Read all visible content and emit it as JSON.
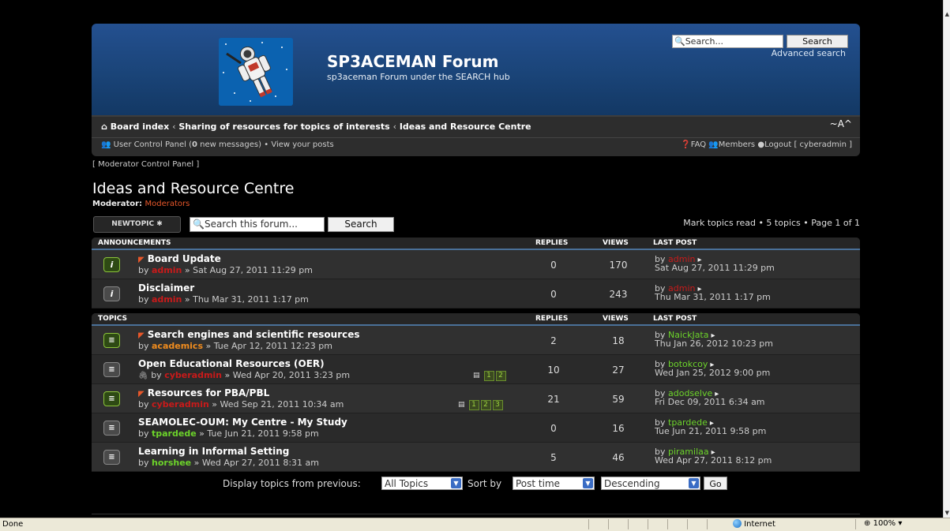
{
  "header": {
    "site_title": "SP3ACEMAN Forum",
    "site_description": "sp3aceman Forum under the SEARCH hub",
    "search_placeholder": "Search...",
    "search_button": "Search",
    "advanced_search": "Advanced search"
  },
  "nav": {
    "breadcrumbs": [
      "Board index",
      "Sharing of resources for topics of interests",
      "Ideas and Resource Centre"
    ],
    "font_size_control": "~A^",
    "ucp_label": "User Control Panel (",
    "new_messages_count": "0",
    "ucp_label_end": " new messages)",
    "view_posts": "View your posts",
    "faq": "FAQ",
    "members": "Members",
    "logout": "Logout [ cyberadmin ]"
  },
  "mcp_link": "[ Moderator Control Panel ]",
  "forum": {
    "title": "Ideas and Resource Centre",
    "moderator_label": "Moderator:",
    "moderator_value": "Moderators"
  },
  "actions": {
    "new_topic": "NEWTOPIC ✱",
    "search_placeholder": "Search this forum...",
    "search_button": "Search",
    "pagination": "Mark topics read • 5 topics • Page 1 of 1"
  },
  "announcements": {
    "header": {
      "title": "ANNOUNCEMENTS",
      "replies": "REPLIES",
      "views": "VIEWS",
      "last_post": "LAST POST"
    },
    "rows": [
      {
        "title": "Board Update",
        "by": "by ",
        "author": "admin",
        "date": " » Sat Aug 27, 2011 11:29 pm",
        "replies": "0",
        "views": "170",
        "last_by": "by ",
        "last_author": "admin",
        "last_date": "Sat Aug 27, 2011 11:29 pm"
      },
      {
        "title": "Disclaimer",
        "by": "by ",
        "author": "admin",
        "date": " » Thu Mar 31, 2011 1:17 pm",
        "replies": "0",
        "views": "243",
        "last_by": "by ",
        "last_author": "admin",
        "last_date": "Thu Mar 31, 2011 1:17 pm"
      }
    ]
  },
  "topics": {
    "header": {
      "title": "TOPICS",
      "replies": "REPLIES",
      "views": "VIEWS",
      "last_post": "LAST POST"
    },
    "rows": [
      {
        "title": "Search engines and scientific resources",
        "by": "by ",
        "author": "academics",
        "date": " » Tue Apr 12, 2011 12:23 pm",
        "replies": "2",
        "views": "18",
        "last_by": "by ",
        "last_author": "NaickJata",
        "last_date": "Thu Jan 26, 2012 10:23 pm"
      },
      {
        "title": "Open Educational Resources (OER)",
        "by": "by ",
        "author": "cyberadmin",
        "date": " » Wed Apr 20, 2011 3:23 pm",
        "pages": [
          "1",
          "2"
        ],
        "replies": "10",
        "views": "27",
        "last_by": "by ",
        "last_author": "botokcoy",
        "last_date": "Wed Jan 25, 2012 9:00 pm"
      },
      {
        "title": "Resources for PBA/PBL",
        "by": "by ",
        "author": "cyberadmin",
        "date": " » Wed Sep 21, 2011 10:34 am",
        "pages": [
          "1",
          "2",
          "3"
        ],
        "replies": "21",
        "views": "59",
        "last_by": "by ",
        "last_author": "adodselve",
        "last_date": "Fri Dec 09, 2011 6:34 am"
      },
      {
        "title": "SEAMOLEC-OUM: My Centre - My Study",
        "by": "by ",
        "author": "tpardede",
        "date": " » Tue Jun 21, 2011 9:58 pm",
        "replies": "0",
        "views": "16",
        "last_by": "by ",
        "last_author": "tpardede",
        "last_date": "Tue Jun 21, 2011 9:58 pm"
      },
      {
        "title": "Learning in Informal Setting",
        "by": "by ",
        "author": "horshee",
        "date": " » Wed Apr 27, 2011 8:31 am",
        "replies": "5",
        "views": "46",
        "last_by": "by ",
        "last_author": "piramilaa",
        "last_date": "Wed Apr 27, 2011 8:12 pm"
      }
    ]
  },
  "display": {
    "label_from": "Display topics from previous:",
    "from_value": "All Topics",
    "label_sort": "Sort by",
    "sort_value": "Post time",
    "order_value": "Descending",
    "go": "Go"
  },
  "statusbar": {
    "status": "Done",
    "zone": "Internet",
    "zoom": "100%"
  },
  "colors": {
    "header_blue": "#1a4478",
    "username_admin": "#c81a1a",
    "username_user": "#f08c1e",
    "username_member": "#6cd32a",
    "accent_orange": "#e8572a"
  }
}
